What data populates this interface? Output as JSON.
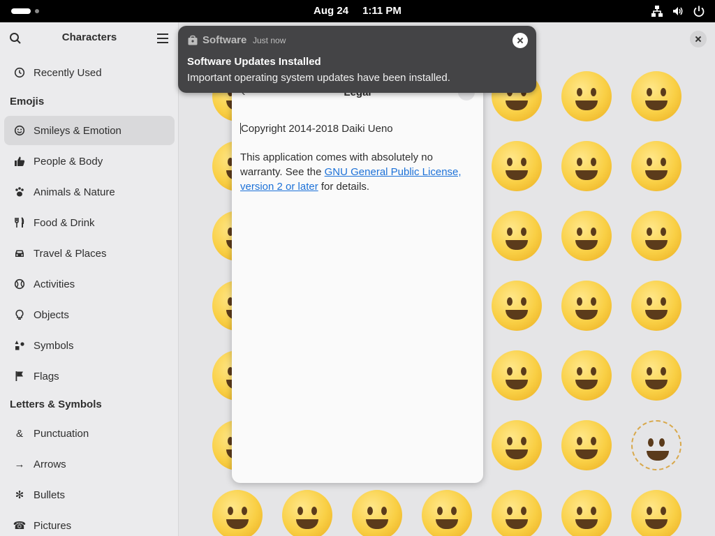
{
  "topbar": {
    "date": "Aug 24",
    "time": "1:11 PM"
  },
  "sidebar": {
    "title": "Characters",
    "recently_used": "Recently Used",
    "sections": {
      "emojis": "Emojis",
      "letters": "Letters & Symbols"
    },
    "emoji_items": [
      {
        "label": "Smileys & Emotion",
        "icon": "smiley-icon",
        "active": true
      },
      {
        "label": "People & Body",
        "icon": "thumbs-up-icon"
      },
      {
        "label": "Animals & Nature",
        "icon": "paw-icon"
      },
      {
        "label": "Food & Drink",
        "icon": "fork-knife-icon"
      },
      {
        "label": "Travel & Places",
        "icon": "car-icon"
      },
      {
        "label": "Activities",
        "icon": "ball-icon"
      },
      {
        "label": "Objects",
        "icon": "lightbulb-icon"
      },
      {
        "label": "Symbols",
        "icon": "symbols-icon"
      },
      {
        "label": "Flags",
        "icon": "flag-icon"
      }
    ],
    "letter_items": [
      {
        "label": "Punctuation",
        "icon": "ampersand-icon",
        "glyph": "&"
      },
      {
        "label": "Arrows",
        "icon": "arrow-icon",
        "glyph": "→"
      },
      {
        "label": "Bullets",
        "icon": "bullet-icon",
        "glyph": "✻"
      },
      {
        "label": "Pictures",
        "icon": "phone-icon",
        "glyph": "☎"
      }
    ]
  },
  "dialog": {
    "title": "Legal",
    "copyright": "Copyright 2014-2018 Daiki Ueno",
    "warranty_pre": "This application comes with absolutely no warranty. See the ",
    "license_link": "GNU General Public License, version 2 or later",
    "warranty_post": " for details."
  },
  "notification": {
    "app": "Software",
    "time": "Just now",
    "title": "Software Updates Installed",
    "body": "Important operating system updates have been installed."
  }
}
